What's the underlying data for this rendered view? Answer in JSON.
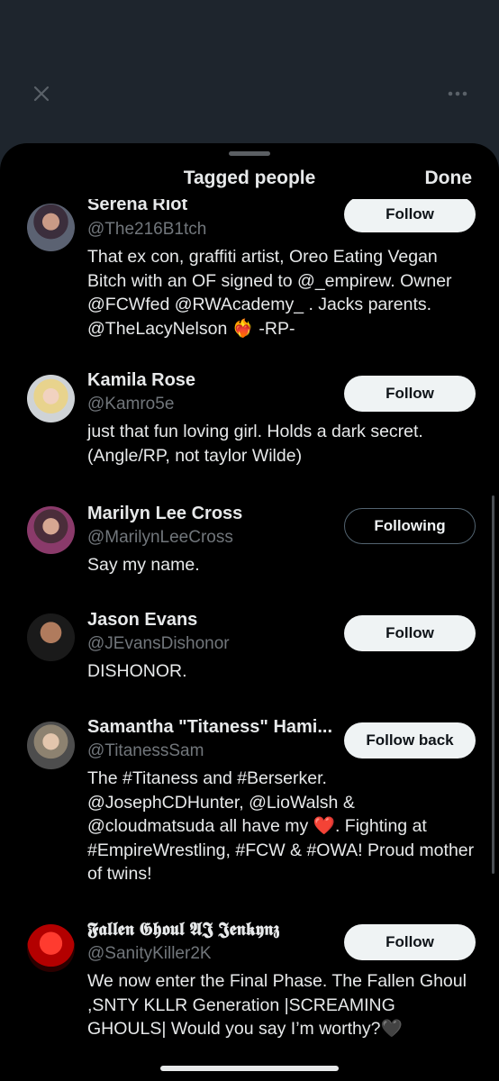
{
  "sheet": {
    "title": "Tagged people",
    "done_label": "Done"
  },
  "users": [
    {
      "name": "Serena Riot",
      "handle": "@The216B1tch",
      "button": "Follow",
      "bio": "That ex con, graffiti artist, Oreo Eating Vegan Bitch with an OF signed to @_empirew. Owner @FCWfed @RWAcademy_ . Jacks parents. @TheLacyNelson ❤️‍🔥 -RP-"
    },
    {
      "name": "Kamila Rose",
      "handle": "@Kamro5e",
      "button": "Follow",
      "bio": "just that fun loving girl. Holds a dark secret. (Angle/RP, not taylor Wilde)"
    },
    {
      "name": "Marilyn Lee Cross",
      "handle": "@MarilynLeeCross",
      "button": "Following",
      "bio": "Say my name."
    },
    {
      "name": "Jason Evans",
      "handle": "@JEvansDishonor",
      "button": "Follow",
      "bio": "DISHONOR."
    },
    {
      "name": "Samantha \"Titaness\" Hami...",
      "handle": "@TitanessSam",
      "button": "Follow back",
      "bio": "The #Titaness and #Berserker. @JosephCDHunter, @LioWalsh & @cloudmatsuda all have my ❤️. Fighting at #EmpireWrestling, #FCW & #OWA! Proud mother of twins!"
    },
    {
      "name": "𝕱𝖆𝖑𝖑𝖊𝖓 𝕲𝖍𝖔𝖚𝖑 𝕬𝕵 𝕵𝖊𝖓𝖐𝖞𝖓𝖟",
      "handle": "@SanityKiller2K",
      "button": "Follow",
      "bio": "We now enter the Final Phase. The Fallen Ghoul ,SNTY KLLR Generation |SCREAMING GHOULS| Would you say I’m worthy?🖤"
    }
  ],
  "icons": {
    "close": "close-icon",
    "more": "more-icon"
  },
  "colors": {
    "sheet_bg": "#000000",
    "backdrop": "#1e252d",
    "secondary_text": "#71767b",
    "button_bg": "#eff3f4"
  }
}
